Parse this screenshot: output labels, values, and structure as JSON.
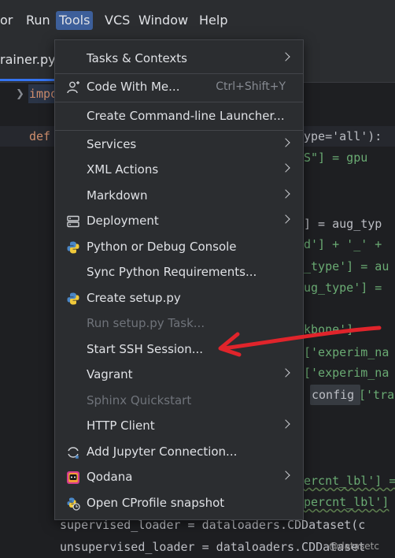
{
  "menubar": {
    "items": [
      "or",
      "Run",
      "Tools",
      "VCS",
      "Window",
      "Help"
    ],
    "active": "Tools"
  },
  "tab": {
    "filename": "rainer.py"
  },
  "editor": {
    "line1": "impo",
    "line2_kw": "def",
    "frag_ype_all": "ype='all'):",
    "frag_s_gpu_pre": "S\"] = gpu",
    "frag_aug_type": "] = aug_typ",
    "frag_d_plus": "d'] + '_' +",
    "frag_type_au": "_type'] = au",
    "frag_ug_type": "ug_type'] =",
    "frag_kbone": "kbone']",
    "frag_experim1": "['experim_na",
    "frag_experim2": "['experim_na",
    "frag_config_a": "config",
    "frag_config_b": "['tra",
    "frag_ercnt1": "ercnt_lbl'] =",
    "frag_ercnt2": "percnt_lbl']",
    "line_supervised": "supervised_loader = dataloaders.CDDataset(c",
    "line_unsupervised": "unsupervised_loader = dataloaders.CDDataset",
    "watermark": "@datasetc"
  },
  "menu": {
    "items": [
      {
        "label": "Tasks & Contexts",
        "submenu": true,
        "icon": ""
      },
      {
        "label": "Code With Me...",
        "shortcut": "Ctrl+Shift+Y",
        "icon": "add-user-icon"
      },
      {
        "label": "Create Command-line Launcher...",
        "icon": ""
      },
      {
        "label": "Services",
        "submenu": true,
        "icon": ""
      },
      {
        "label": "XML Actions",
        "submenu": true,
        "icon": ""
      },
      {
        "label": "Markdown",
        "submenu": true,
        "icon": ""
      },
      {
        "label": "Deployment",
        "submenu": true,
        "icon": "server-icon"
      },
      {
        "label": "Python or Debug Console",
        "icon": "python-icon"
      },
      {
        "label": "Sync Python Requirements...",
        "icon": ""
      },
      {
        "label": "Create setup.py",
        "icon": "python-icon"
      },
      {
        "label": "Run setup.py Task...",
        "disabled": true,
        "icon": ""
      },
      {
        "label": "Start SSH Session...",
        "icon": ""
      },
      {
        "label": "Vagrant",
        "submenu": true,
        "icon": ""
      },
      {
        "label": "Sphinx Quickstart",
        "disabled": true,
        "icon": ""
      },
      {
        "label": "HTTP Client",
        "submenu": true,
        "icon": ""
      },
      {
        "label": "Add Jupyter Connection...",
        "icon": "jupyter-icon"
      },
      {
        "label": "Qodana",
        "submenu": true,
        "icon": "qodana-icon"
      },
      {
        "label": "Open CProfile snapshot",
        "icon": "cprofile-icon"
      }
    ]
  },
  "colors": {
    "accent": "#3574f0",
    "annotation": "#e0242b"
  }
}
